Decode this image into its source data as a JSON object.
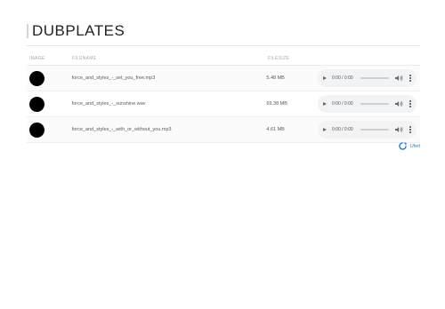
{
  "header": {
    "title": "DUBPLATES"
  },
  "table": {
    "columns": {
      "image": "IMAGE",
      "filename": "FILENAME",
      "filesize": "FILESIZE"
    },
    "rows": [
      {
        "filename": "force_and_styles_-_set_you_free.mp3",
        "filesize": "5.48 MB",
        "time": "0:00 / 0:00"
      },
      {
        "filename": "force_and_styles_-_sunshine.wav",
        "filesize": "69.38 MB",
        "time": "0:00 / 0:00"
      },
      {
        "filename": "force_and_styles_-_with_or_without_you.mp3",
        "filesize": "4.61 MB",
        "time": "0:00 / 0:00"
      }
    ]
  },
  "footer": {
    "brand_label": "Ufeit",
    "brand_color": "#2a7bd3"
  },
  "icons": {
    "play": "play-icon",
    "volume": "volume-icon",
    "more": "more-vertical-icon",
    "brand": "brand-logo-icon"
  }
}
